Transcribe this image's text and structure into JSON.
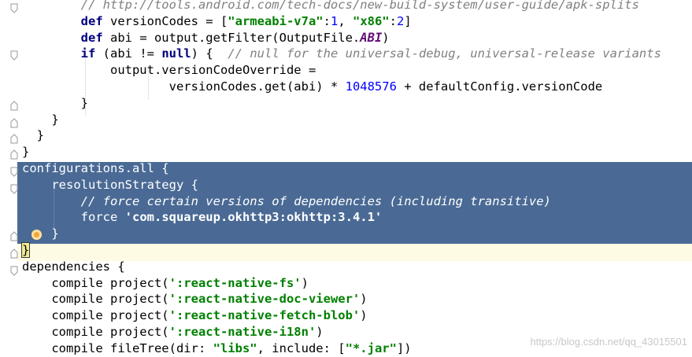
{
  "editor": {
    "lines": [
      {
        "id": "l1",
        "segs": [
          {
            "t": "        "
          },
          {
            "t": "// http://tools.android.com/tech-docs/new-build-system/user-guide/apk-splits",
            "c": "cmt"
          }
        ]
      },
      {
        "id": "l2",
        "segs": [
          {
            "t": "        "
          },
          {
            "t": "def",
            "c": "kw"
          },
          {
            "t": " versionCodes = ["
          },
          {
            "t": "\"armeabi-v7a\"",
            "c": "str"
          },
          {
            "t": ":"
          },
          {
            "t": "1",
            "c": "num"
          },
          {
            "t": ", "
          },
          {
            "t": "\"x86\"",
            "c": "str"
          },
          {
            "t": ":"
          },
          {
            "t": "2",
            "c": "num"
          },
          {
            "t": "]"
          }
        ]
      },
      {
        "id": "l3",
        "segs": [
          {
            "t": "        "
          },
          {
            "t": "def",
            "c": "kw"
          },
          {
            "t": " abi = output.getFilter(OutputFile."
          },
          {
            "t": "ABI",
            "c": "cls"
          },
          {
            "t": ")"
          }
        ]
      },
      {
        "id": "l4",
        "segs": [
          {
            "t": "        "
          },
          {
            "t": "if",
            "c": "kw"
          },
          {
            "t": " (abi != "
          },
          {
            "t": "null",
            "c": "kw"
          },
          {
            "t": ") {  "
          },
          {
            "t": "// null for the universal-debug, universal-release variants",
            "c": "cmt"
          }
        ]
      },
      {
        "id": "l5",
        "segs": [
          {
            "t": "            output.versionCodeOverride ="
          }
        ]
      },
      {
        "id": "l6",
        "segs": [
          {
            "t": "                    versionCodes.get(abi) * "
          },
          {
            "t": "1048576",
            "c": "num"
          },
          {
            "t": " + defaultConfig.versionCode"
          }
        ]
      },
      {
        "id": "l7",
        "segs": [
          {
            "t": "        }"
          }
        ]
      },
      {
        "id": "l8",
        "segs": [
          {
            "t": "    }"
          }
        ]
      },
      {
        "id": "l9",
        "segs": [
          {
            "t": "  }"
          }
        ]
      },
      {
        "id": "l10",
        "segs": [
          {
            "t": "}"
          }
        ]
      },
      {
        "id": "l11",
        "sel": true,
        "segs": [
          {
            "t": "configurations.all {"
          }
        ]
      },
      {
        "id": "l12",
        "sel": true,
        "segs": [
          {
            "t": "    resolutionStrategy {"
          }
        ]
      },
      {
        "id": "l13",
        "sel": true,
        "segs": [
          {
            "t": "        "
          },
          {
            "t": "// force certain versions of dependencies (including transitive)",
            "c": "cmt"
          }
        ]
      },
      {
        "id": "l14",
        "sel": true,
        "segs": [
          {
            "t": "        force "
          },
          {
            "t": "'com.squareup.okhttp3:okhttp:3.4.1'",
            "c": "str"
          }
        ]
      },
      {
        "id": "l15",
        "sel": true,
        "segs": [
          {
            "t": "    }"
          }
        ]
      },
      {
        "id": "l16",
        "segs": [
          {
            "t": "}",
            "c": "brace-hl"
          }
        ]
      },
      {
        "id": "l17",
        "segs": [
          {
            "t": "dependencies {"
          }
        ]
      },
      {
        "id": "l18",
        "segs": [
          {
            "t": "    compile project("
          },
          {
            "t": "':react-native-fs'",
            "c": "str"
          },
          {
            "t": ")"
          }
        ]
      },
      {
        "id": "l19",
        "segs": [
          {
            "t": "    compile project("
          },
          {
            "t": "':react-native-doc-viewer'",
            "c": "str"
          },
          {
            "t": ")"
          }
        ]
      },
      {
        "id": "l20",
        "segs": [
          {
            "t": "    compile project("
          },
          {
            "t": "':react-native-fetch-blob'",
            "c": "str"
          },
          {
            "t": ")"
          }
        ]
      },
      {
        "id": "l21",
        "segs": [
          {
            "t": "    compile project("
          },
          {
            "t": "':react-native-i18n'",
            "c": "str"
          },
          {
            "t": ")"
          }
        ]
      },
      {
        "id": "l22",
        "segs": [
          {
            "t": "    compile fileTree(dir: "
          },
          {
            "t": "\"libs\"",
            "c": "str"
          },
          {
            "t": ", include: ["
          },
          {
            "t": "\"*.jar\"",
            "c": "str"
          },
          {
            "t": "])"
          }
        ]
      }
    ]
  },
  "watermark": "https://blog.csdn.net/qq_43015501"
}
